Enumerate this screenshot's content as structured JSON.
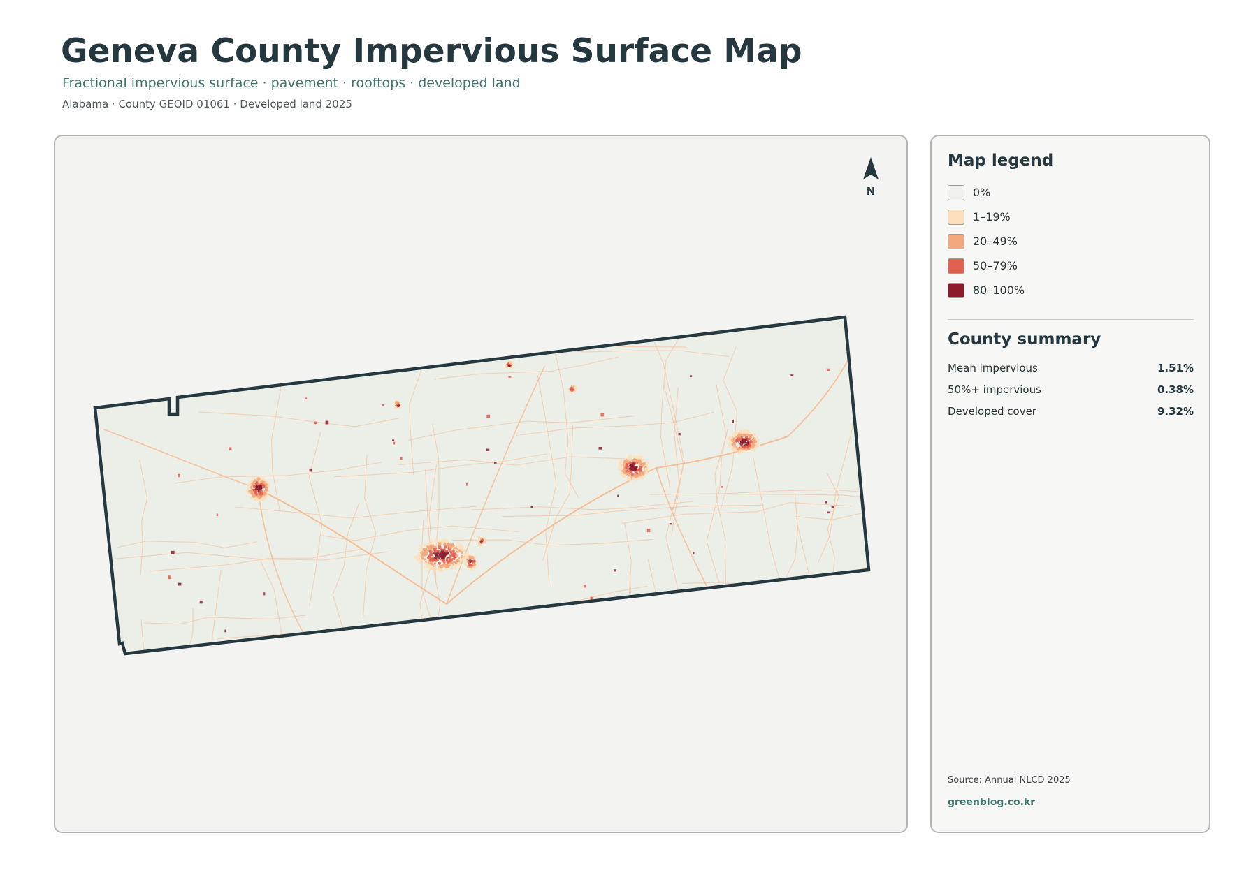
{
  "header": {
    "title": "Geneva County Impervious Surface Map",
    "subtitle": "Fractional impervious surface · pavement · rooftops · developed land",
    "meta": "Alabama · County GEOID 01061 · Developed land 2025"
  },
  "map": {
    "north_label": "N",
    "county_fill": "#eceee8",
    "boundary_color": "#25373f",
    "road_color": "#f6b98c"
  },
  "legend": {
    "heading": "Map legend",
    "items": [
      {
        "label": "0%",
        "color": "#f0f0ee"
      },
      {
        "label": "1–19%",
        "color": "#fde0bb"
      },
      {
        "label": "20–49%",
        "color": "#f3a77a"
      },
      {
        "label": "50–79%",
        "color": "#e05f4e"
      },
      {
        "label": "80–100%",
        "color": "#8c1b2c"
      }
    ]
  },
  "summary": {
    "heading": "County summary",
    "stats": [
      {
        "label": "Mean impervious",
        "value": "1.51%"
      },
      {
        "label": "50%+ impervious",
        "value": "0.38%"
      },
      {
        "label": "Developed cover",
        "value": "9.32%"
      }
    ]
  },
  "footer": {
    "source": "Source: Annual NLCD 2025",
    "site": "greenblog.co.kr"
  }
}
